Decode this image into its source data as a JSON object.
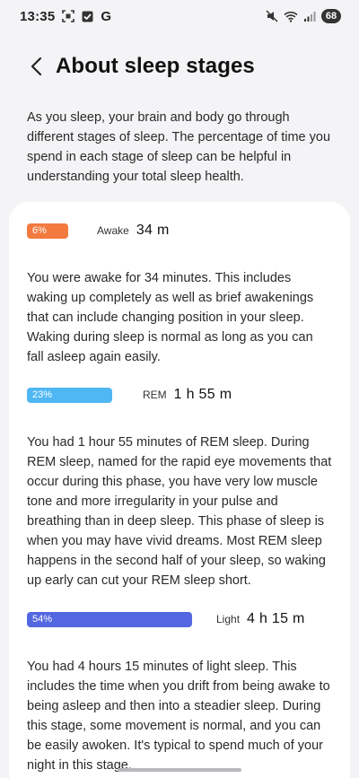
{
  "status_bar": {
    "time": "13:35",
    "g_label": "G",
    "battery": "68"
  },
  "header": {
    "title": "About sleep stages"
  },
  "intro": "As you sleep, your brain and body go through different stages of sleep. The percentage of time you spend in each stage of sleep can be helpful in understanding your total sleep health.",
  "stages": [
    {
      "percent_label": "6%",
      "percent": 6,
      "name": "Awake",
      "duration": "34 m",
      "color": "#f27a3f",
      "description": "You were awake for 34 minutes. This includes waking up completely as well as brief awakenings that can include changing position in your sleep. Waking during sleep is normal as long as you can fall asleep again easily."
    },
    {
      "percent_label": "23%",
      "percent": 23,
      "name": "REM",
      "duration": "1 h 55 m",
      "color": "#4fb7f3",
      "description": "You had 1 hour 55 minutes of REM sleep. During REM sleep, named for the rapid eye movements that occur during this phase, you have very low muscle tone and more irregularity in your pulse and breathing than in deep sleep. This phase of sleep is when you may have vivid dreams. Most REM sleep happens in the second half of your sleep, so waking up early can cut your REM sleep short."
    },
    {
      "percent_label": "54%",
      "percent": 54,
      "name": "Light",
      "duration": "4 h 15 m",
      "color": "#5267e0",
      "description": "You had 4 hours 15 minutes of light sleep. This includes the time when you drift from being awake to being asleep and then into a steadier sleep. During this stage, some movement is normal, and you can be easily awoken. It's typical to spend much of your night in this stage."
    }
  ]
}
